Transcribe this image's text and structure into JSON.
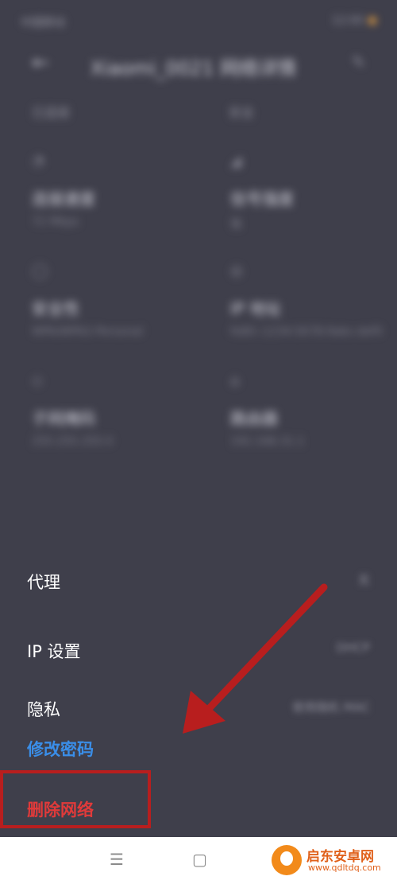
{
  "status": {
    "left": "中国移动",
    "right": "12:00"
  },
  "header": {
    "title": "Xiaomi_0021 网络详情"
  },
  "subrow": {
    "left": "已连接",
    "right": "安全"
  },
  "grid": [
    {
      "title": "连接速度",
      "value": "72 Mbps"
    },
    {
      "title": "信号强度",
      "value": "强"
    },
    {
      "title": "安全性",
      "value": "WPA/WPA2-Personal"
    },
    {
      "title": "IP 地址",
      "value": "fe80::1234:5678:9abc:def0"
    },
    {
      "title": "子网掩码",
      "value": "255.255.255.0"
    },
    {
      "title": "路由器",
      "value": "192.168.31.1"
    }
  ],
  "settings": {
    "proxy": {
      "label": "代理",
      "value": "无"
    },
    "ip": {
      "label": "IP 设置",
      "value": "DHCP"
    },
    "privacy": {
      "label": "隐私",
      "value": "使用随机 MAC"
    }
  },
  "actions": {
    "change_password": "修改密码",
    "delete_network": "删除网络"
  },
  "watermark": {
    "name": "启东安卓网",
    "url": "www.qdltdq.com"
  },
  "colors": {
    "accent_blue": "#3a8ee8",
    "danger_red": "#e03a3a",
    "annotation_red": "#b81e1e"
  }
}
